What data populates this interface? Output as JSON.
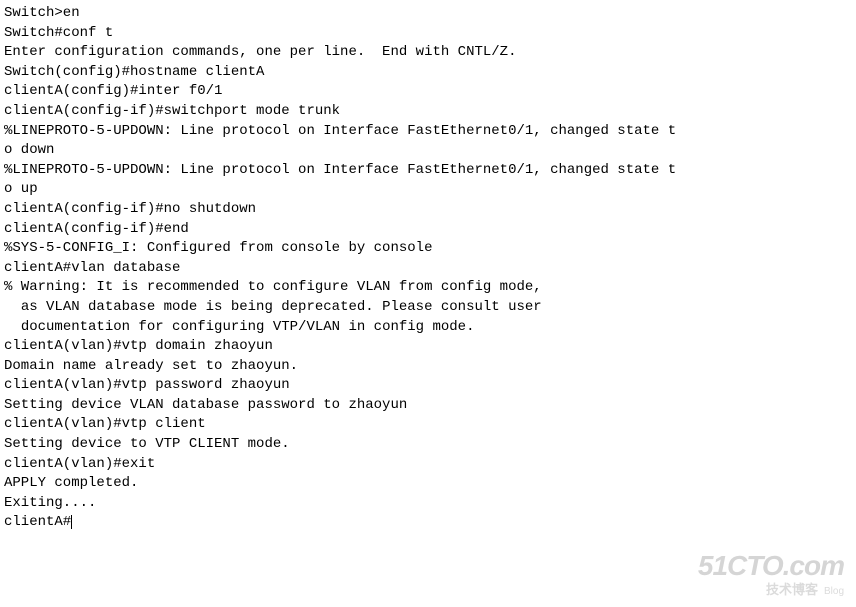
{
  "terminal": {
    "lines": [
      "Switch>en",
      "Switch#conf t",
      "Enter configuration commands, one per line.  End with CNTL/Z.",
      "Switch(config)#hostname clientA",
      "clientA(config)#inter f0/1",
      "clientA(config-if)#switchport mode trunk",
      "",
      "%LINEPROTO-5-UPDOWN: Line protocol on Interface FastEthernet0/1, changed state t",
      "o down",
      "",
      "%LINEPROTO-5-UPDOWN: Line protocol on Interface FastEthernet0/1, changed state t",
      "o up",
      "",
      "clientA(config-if)#no shutdown",
      "clientA(config-if)#end",
      "",
      "%SYS-5-CONFIG_I: Configured from console by console",
      "clientA#vlan database",
      "% Warning: It is recommended to configure VLAN from config mode,",
      "  as VLAN database mode is being deprecated. Please consult user",
      "  documentation for configuring VTP/VLAN in config mode.",
      "",
      "clientA(vlan)#vtp domain zhaoyun",
      "Domain name already set to zhaoyun.",
      "clientA(vlan)#vtp password zhaoyun",
      "Setting device VLAN database password to zhaoyun",
      "clientA(vlan)#vtp client",
      "Setting device to VTP CLIENT mode.",
      "clientA(vlan)#exit",
      "APPLY completed.",
      "Exiting....",
      "clientA#"
    ]
  },
  "watermark": {
    "main": "51CTO.com",
    "sub_cn": "技术博客",
    "sub_en": "Blog"
  }
}
